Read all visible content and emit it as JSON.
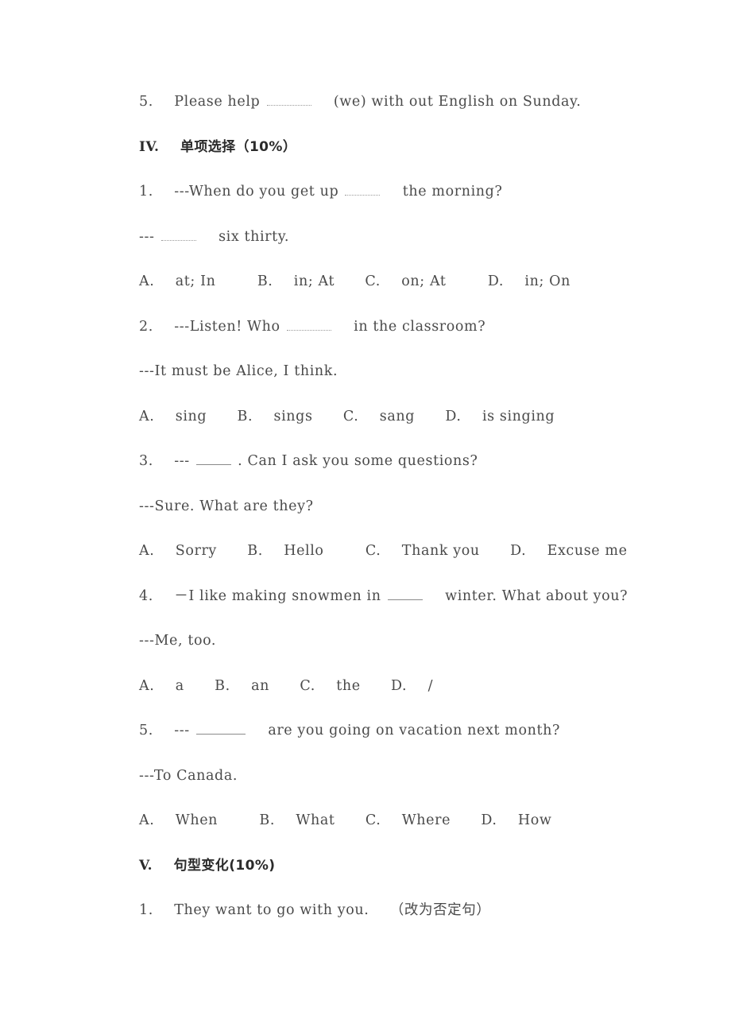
{
  "document": {
    "type": "english-exam-worksheet-page",
    "language": "zh-CN/en",
    "background_color": "#ffffff",
    "text_color": "#4a4a4a"
  },
  "carryover_item": {
    "number": "5.",
    "text_before_blank": "Please help",
    "text_after_blank": "(we) with out English on Sunday."
  },
  "section_4": {
    "numeral": "IV.",
    "title": "单项选择（10%）",
    "questions": [
      {
        "number": "1.",
        "prompt_before_blank": "---When do you get up",
        "prompt_after_blank": "the morning?",
        "answer_line_before_blank": "---",
        "answer_line_after_blank": "six thirty.",
        "options": [
          {
            "letter": "A.",
            "text": "at; In"
          },
          {
            "letter": "B.",
            "text": "in; At"
          },
          {
            "letter": "C.",
            "text": "on; At"
          },
          {
            "letter": "D.",
            "text": "in; On"
          }
        ]
      },
      {
        "number": "2.",
        "prompt_before_blank": "---Listen! Who",
        "prompt_after_blank": "in the classroom?",
        "answer_line": "---It must be Alice, I think.",
        "options": [
          {
            "letter": "A.",
            "text": "sing"
          },
          {
            "letter": "B.",
            "text": "sings"
          },
          {
            "letter": "C.",
            "text": "sang"
          },
          {
            "letter": "D.",
            "text": "is singing"
          }
        ]
      },
      {
        "number": "3.",
        "prompt_before_blank": "---",
        "prompt_after_blank": ". Can I ask you some questions?",
        "answer_line": "---Sure. What are they?",
        "options": [
          {
            "letter": "A.",
            "text": "Sorry"
          },
          {
            "letter": "B.",
            "text": "Hello"
          },
          {
            "letter": "C.",
            "text": "Thank you"
          },
          {
            "letter": "D.",
            "text": "Excuse me"
          }
        ]
      },
      {
        "number": "4.",
        "prompt_before_blank": "－I like making snowmen in",
        "prompt_after_blank": "winter. What about you?",
        "answer_line": "---Me, too.",
        "options": [
          {
            "letter": "A.",
            "text": "a"
          },
          {
            "letter": "B.",
            "text": "an"
          },
          {
            "letter": "C.",
            "text": "the"
          },
          {
            "letter": "D.",
            "text": "/"
          }
        ]
      },
      {
        "number": "5.",
        "prompt_before_blank": "---",
        "prompt_after_blank": "are you going on vacation next month?",
        "answer_line": "---To Canada.",
        "options": [
          {
            "letter": "A.",
            "text": "When"
          },
          {
            "letter": "B.",
            "text": "What"
          },
          {
            "letter": "C.",
            "text": "Where"
          },
          {
            "letter": "D.",
            "text": "How"
          }
        ]
      }
    ]
  },
  "section_5": {
    "numeral": "V.",
    "title": "句型变化(10%)",
    "questions": [
      {
        "number": "1.",
        "text": "They want to go with you.",
        "instruction": "（改为否定句）"
      }
    ]
  }
}
